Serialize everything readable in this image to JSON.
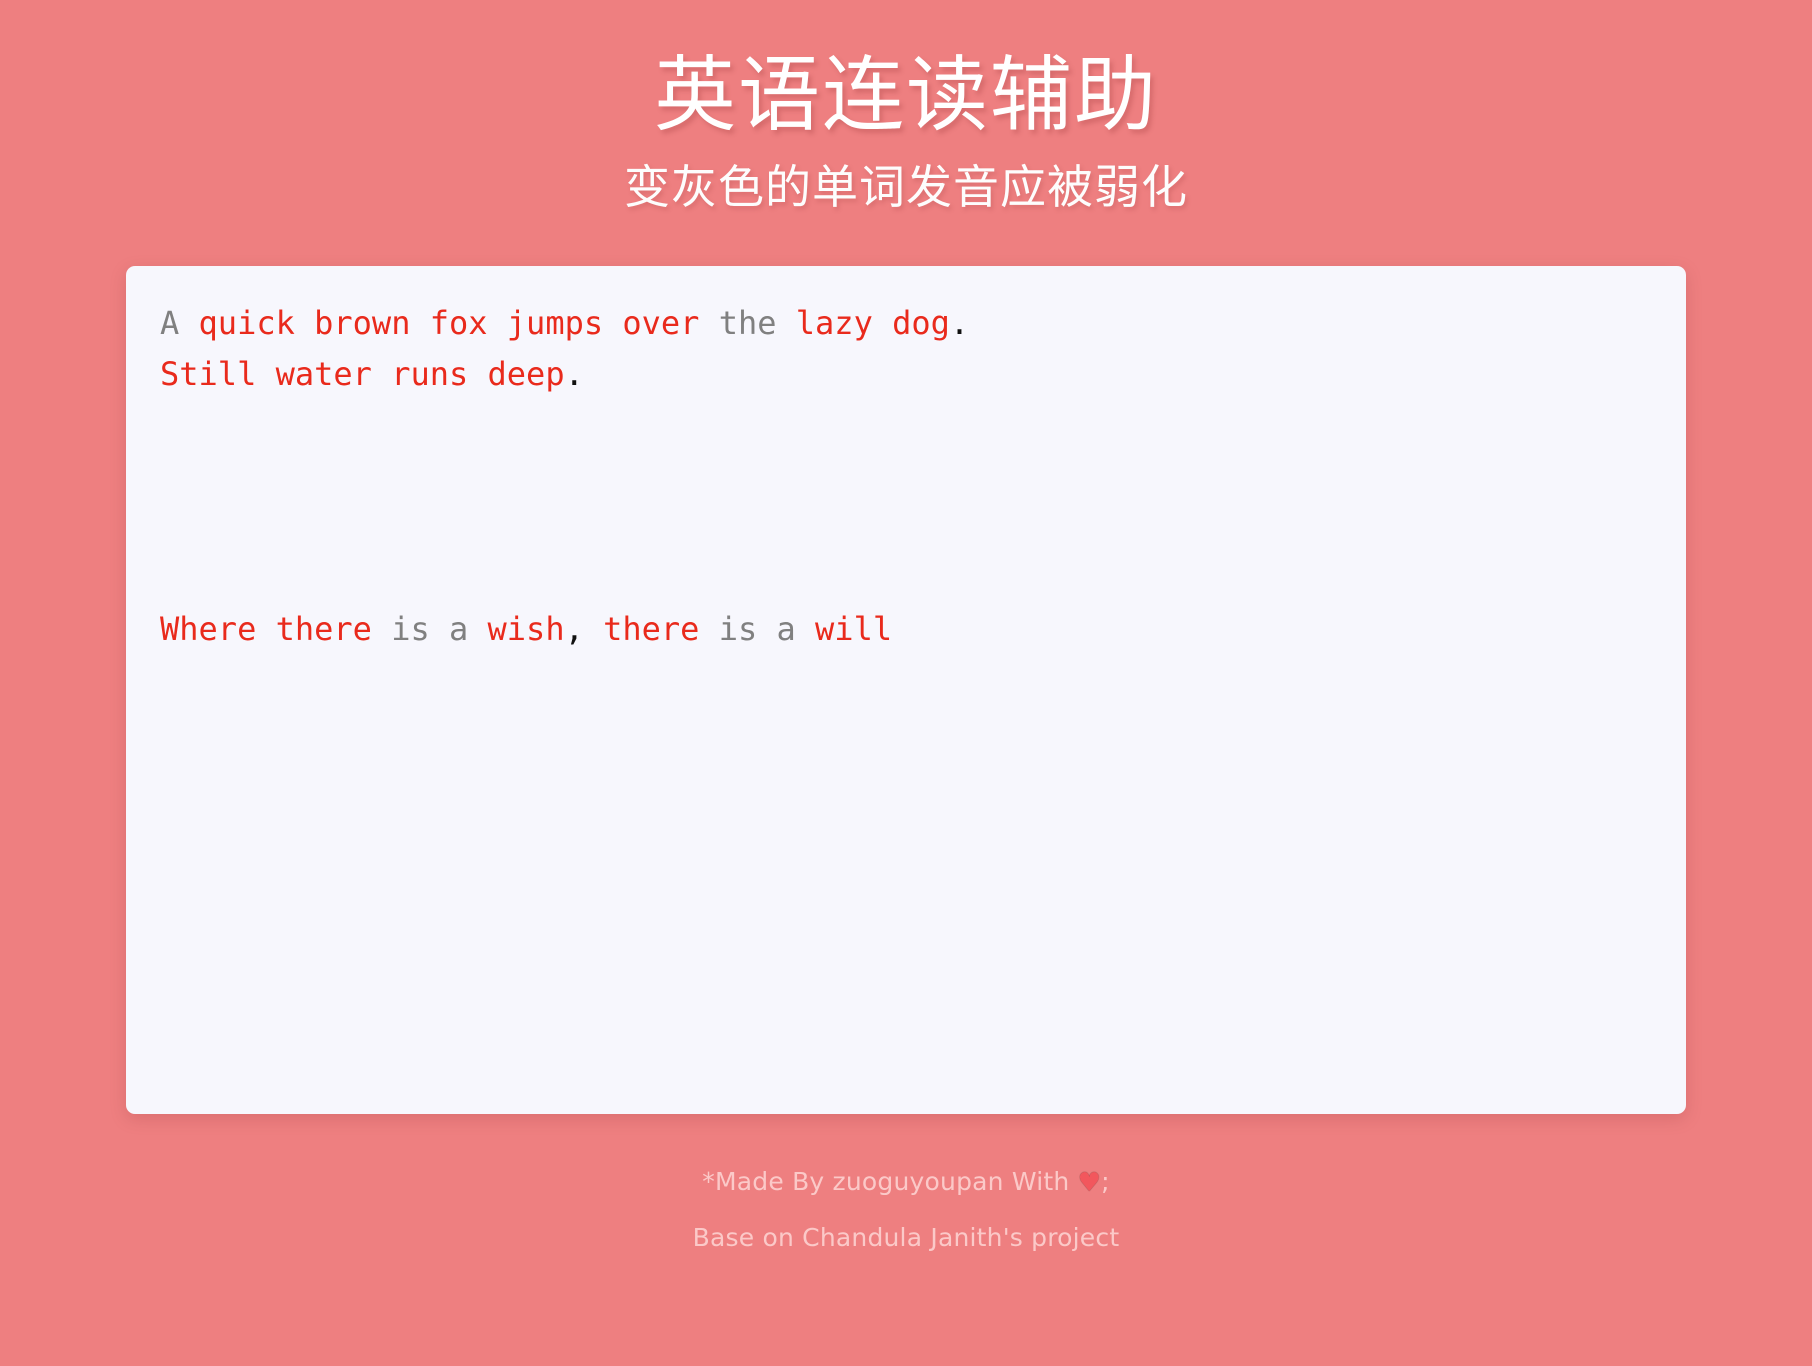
{
  "header": {
    "title": "英语连读辅助",
    "subtitle": "变灰色的单词发音应被弱化"
  },
  "editor": {
    "name": "linking-practice-textarea",
    "placeholder": "",
    "lines": [
      {
        "index": 0,
        "tokens": [
          {
            "text": "A",
            "emphasis": "weak"
          },
          {
            "text": " ",
            "emphasis": "space"
          },
          {
            "text": "quick",
            "emphasis": "strong"
          },
          {
            "text": " ",
            "emphasis": "space"
          },
          {
            "text": "brown",
            "emphasis": "strong"
          },
          {
            "text": " ",
            "emphasis": "space"
          },
          {
            "text": "fox",
            "emphasis": "strong"
          },
          {
            "text": " ",
            "emphasis": "space"
          },
          {
            "text": "jumps",
            "emphasis": "strong"
          },
          {
            "text": " ",
            "emphasis": "space"
          },
          {
            "text": "over",
            "emphasis": "strong"
          },
          {
            "text": " ",
            "emphasis": "space"
          },
          {
            "text": "the",
            "emphasis": "weak"
          },
          {
            "text": " ",
            "emphasis": "space"
          },
          {
            "text": "lazy",
            "emphasis": "strong"
          },
          {
            "text": " ",
            "emphasis": "space"
          },
          {
            "text": "dog",
            "emphasis": "strong"
          },
          {
            "text": ".",
            "emphasis": "punct"
          }
        ]
      },
      {
        "index": 1,
        "tokens": [
          {
            "text": "Still",
            "emphasis": "strong"
          },
          {
            "text": " ",
            "emphasis": "space"
          },
          {
            "text": "water",
            "emphasis": "strong"
          },
          {
            "text": " ",
            "emphasis": "space"
          },
          {
            "text": "runs",
            "emphasis": "strong"
          },
          {
            "text": " ",
            "emphasis": "space"
          },
          {
            "text": "deep",
            "emphasis": "strong"
          },
          {
            "text": ".",
            "emphasis": "punct"
          }
        ]
      },
      {
        "index": 2,
        "tokens": []
      },
      {
        "index": 3,
        "tokens": []
      },
      {
        "index": 4,
        "tokens": []
      },
      {
        "index": 5,
        "tokens": []
      },
      {
        "index": 6,
        "tokens": [
          {
            "text": "Where",
            "emphasis": "strong"
          },
          {
            "text": " ",
            "emphasis": "space"
          },
          {
            "text": "there",
            "emphasis": "strong"
          },
          {
            "text": " ",
            "emphasis": "space"
          },
          {
            "text": "is",
            "emphasis": "weak"
          },
          {
            "text": " ",
            "emphasis": "space"
          },
          {
            "text": "a",
            "emphasis": "weak"
          },
          {
            "text": " ",
            "emphasis": "space"
          },
          {
            "text": "wish",
            "emphasis": "strong"
          },
          {
            "text": ",",
            "emphasis": "punct"
          },
          {
            "text": " ",
            "emphasis": "space"
          },
          {
            "text": "there",
            "emphasis": "strong"
          },
          {
            "text": " ",
            "emphasis": "space"
          },
          {
            "text": "is",
            "emphasis": "weak"
          },
          {
            "text": " ",
            "emphasis": "space"
          },
          {
            "text": "a",
            "emphasis": "weak"
          },
          {
            "text": " ",
            "emphasis": "space"
          },
          {
            "text": "will",
            "emphasis": "strong"
          }
        ]
      }
    ]
  },
  "footer": {
    "credit_prefix": "*Made By zuoguyoupan With ",
    "heart_icon": "heart-icon",
    "heart_glyph": "♥",
    "credit_suffix": ";",
    "base_line": "Base on Chandula Janith's project"
  },
  "colors": {
    "background": "#ee7f80",
    "card": "#f7f7fd",
    "strong_word": "#e92a1c",
    "weak_word": "#808080",
    "punctuation": "#111111",
    "header_text": "#ffffff",
    "footer_text": "#fbc9c8"
  }
}
